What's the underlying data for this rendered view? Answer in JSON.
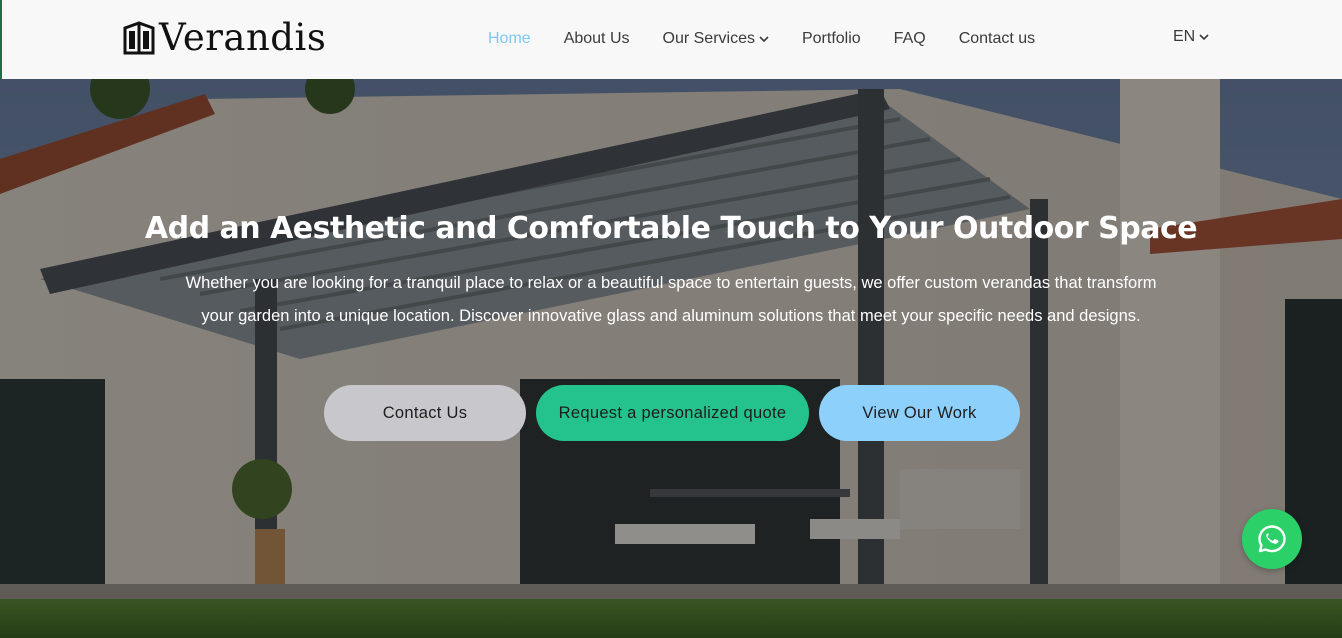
{
  "brand": {
    "name": "Verandis"
  },
  "nav": {
    "items": [
      {
        "label": "Home",
        "active": true
      },
      {
        "label": "About Us"
      },
      {
        "label": "Our Services",
        "dropdown": true
      },
      {
        "label": "Portfolio"
      },
      {
        "label": "FAQ"
      },
      {
        "label": "Contact us"
      }
    ],
    "language": "EN"
  },
  "hero": {
    "title": "Add an Aesthetic and Comfortable Touch to Your Outdoor Space",
    "subtitle": "Whether you are looking for a tranquil place to relax or a beautiful space to entertain guests, we offer custom verandas that transform your garden into a unique location. Discover innovative glass and aluminum solutions that meet your specific needs and designs.",
    "buttons": {
      "contact": "Contact Us",
      "quote": "Request a personalized quote",
      "work": "View Our Work"
    }
  },
  "colors": {
    "nav_active": "#7cc8ef",
    "btn_contact": "#c8c8cc",
    "btn_quote": "#24c38d",
    "btn_work": "#8cd0fb",
    "whatsapp": "#2bd168"
  },
  "icons": {
    "logo": "veranda-logo-icon",
    "dropdown": "chevron-down-icon",
    "chat": "whatsapp-icon"
  }
}
